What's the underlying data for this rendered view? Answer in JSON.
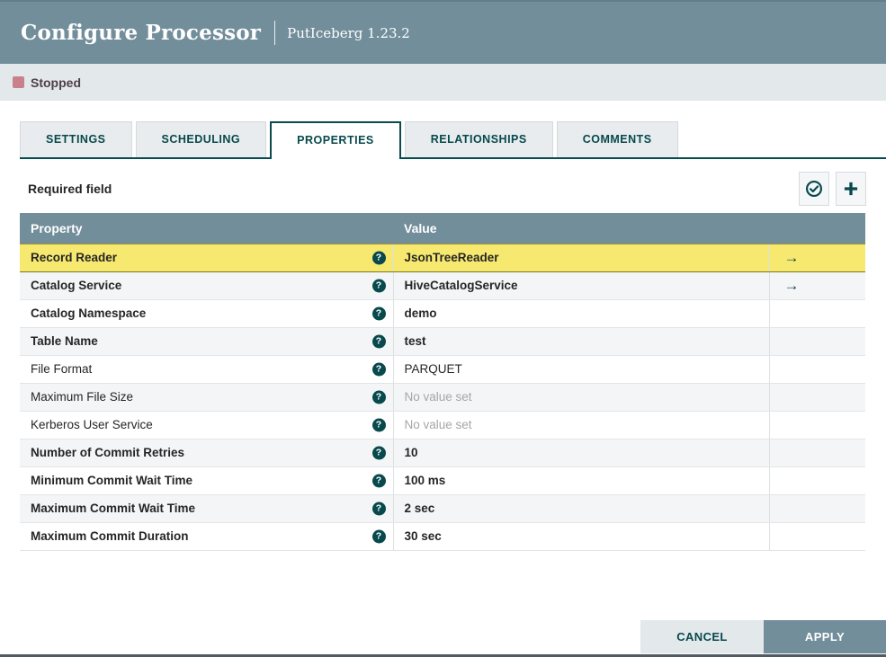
{
  "dialog": {
    "title": "Configure Processor",
    "subtitle": "PutIceberg 1.23.2",
    "status_label": "Stopped"
  },
  "tabs": [
    {
      "label": "SETTINGS",
      "active": false
    },
    {
      "label": "SCHEDULING",
      "active": false
    },
    {
      "label": "PROPERTIES",
      "active": true
    },
    {
      "label": "RELATIONSHIPS",
      "active": false
    },
    {
      "label": "COMMENTS",
      "active": false
    }
  ],
  "properties_tab": {
    "required_field_label": "Required field",
    "toolbar_icons": [
      {
        "name": "verify-properties",
        "icon": "check-circle-icon"
      },
      {
        "name": "add-property",
        "icon": "plus-icon"
      }
    ],
    "table": {
      "columns": [
        "Property",
        "Value"
      ],
      "rows": [
        {
          "property": "Record Reader",
          "value": "JsonTreeReader",
          "required": true,
          "empty": false,
          "highlighted": true,
          "has_goto": true
        },
        {
          "property": "Catalog Service",
          "value": "HiveCatalogService",
          "required": true,
          "empty": false,
          "highlighted": false,
          "has_goto": true
        },
        {
          "property": "Catalog Namespace",
          "value": "demo",
          "required": true,
          "empty": false,
          "highlighted": false,
          "has_goto": false
        },
        {
          "property": "Table Name",
          "value": "test",
          "required": true,
          "empty": false,
          "highlighted": false,
          "has_goto": false
        },
        {
          "property": "File Format",
          "value": "PARQUET",
          "required": false,
          "empty": false,
          "highlighted": false,
          "has_goto": false
        },
        {
          "property": "Maximum File Size",
          "value": "No value set",
          "required": false,
          "empty": true,
          "highlighted": false,
          "has_goto": false
        },
        {
          "property": "Kerberos User Service",
          "value": "No value set",
          "required": false,
          "empty": true,
          "highlighted": false,
          "has_goto": false
        },
        {
          "property": "Number of Commit Retries",
          "value": "10",
          "required": true,
          "empty": false,
          "highlighted": false,
          "has_goto": false
        },
        {
          "property": "Minimum Commit Wait Time",
          "value": "100 ms",
          "required": true,
          "empty": false,
          "highlighted": false,
          "has_goto": false
        },
        {
          "property": "Maximum Commit Wait Time",
          "value": "2 sec",
          "required": true,
          "empty": false,
          "highlighted": false,
          "has_goto": false
        },
        {
          "property": "Maximum Commit Duration",
          "value": "30 sec",
          "required": true,
          "empty": false,
          "highlighted": false,
          "has_goto": false
        }
      ],
      "help_icon_glyph": "?",
      "goto_icon_glyph": "→"
    }
  },
  "footer": {
    "cancel_label": "CANCEL",
    "apply_label": "APPLY"
  },
  "colors": {
    "accent_teal": "#07494C",
    "header_bg": "#728E9B",
    "status_bg": "#E3E8EB",
    "highlight_yellow": "#F7E96F",
    "stopped_icon": "#C8818A"
  }
}
